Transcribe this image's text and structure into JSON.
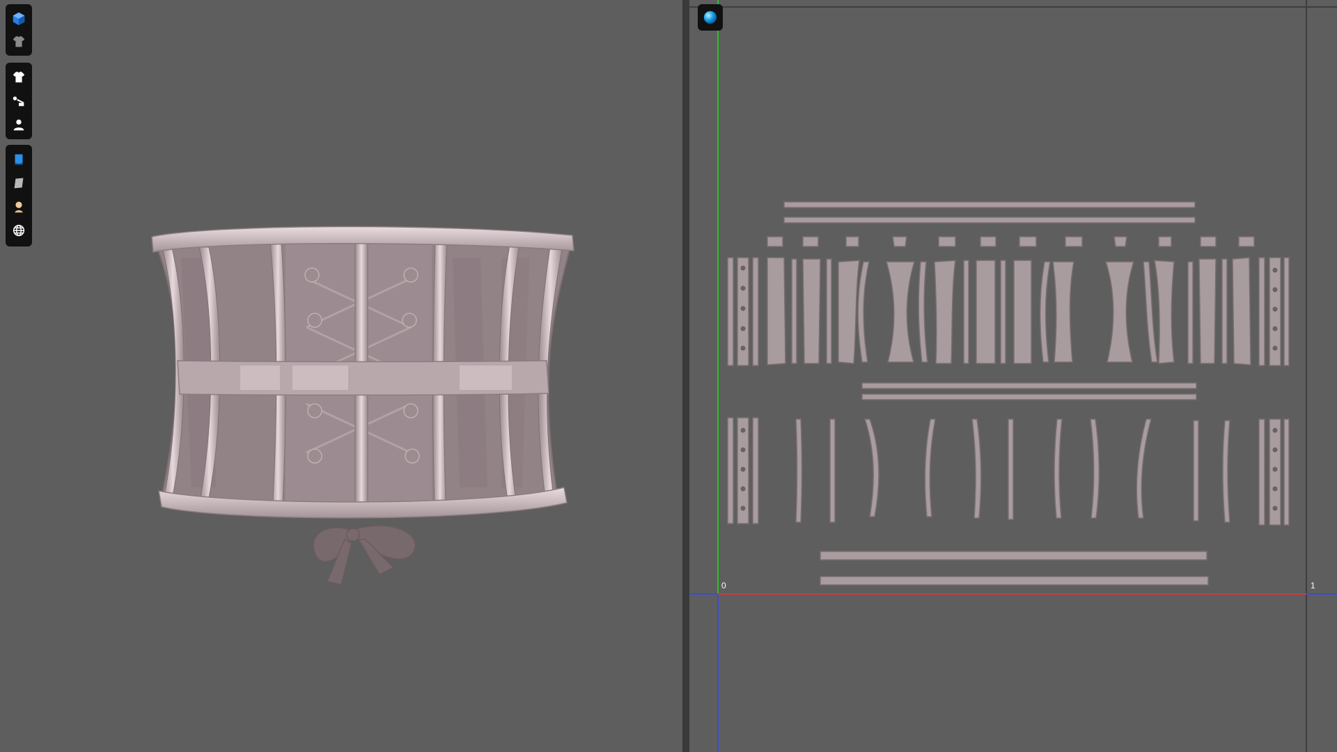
{
  "app": {
    "layout": "split-view",
    "panels": [
      "3d-viewport",
      "uv-editor"
    ]
  },
  "toolbar": {
    "groups": [
      {
        "items": [
          {
            "icon": "3d-cube-icon",
            "active": true
          },
          {
            "icon": "garment-shirt-icon",
            "active": false
          }
        ]
      },
      {
        "items": [
          {
            "icon": "tshirt-icon",
            "active": false
          },
          {
            "icon": "sewing-tools-icon",
            "active": false
          },
          {
            "icon": "avatar-person-icon",
            "active": false
          }
        ]
      },
      {
        "items": [
          {
            "icon": "fabric-blue-icon",
            "active": true
          },
          {
            "icon": "fabric-gray-icon",
            "active": false
          },
          {
            "icon": "skin-avatar-icon",
            "active": false
          },
          {
            "icon": "globe-icon",
            "active": false
          }
        ]
      }
    ]
  },
  "uv_editor": {
    "mode_icon": "sphere-icon",
    "origin_label": "0",
    "unit_label": "1",
    "colors": {
      "v_axis": "#29c229",
      "u_axis": "#d23a3a",
      "bottom_axis": "#3a4cd2",
      "piece_fill": "#a89c9f",
      "piece_stroke": "#7a6f72"
    }
  },
  "viewport": {
    "model": "corset",
    "colors": {
      "background": "#5e5e5e",
      "fabric": "#a8979b",
      "bone": "#c9b9bd"
    }
  }
}
